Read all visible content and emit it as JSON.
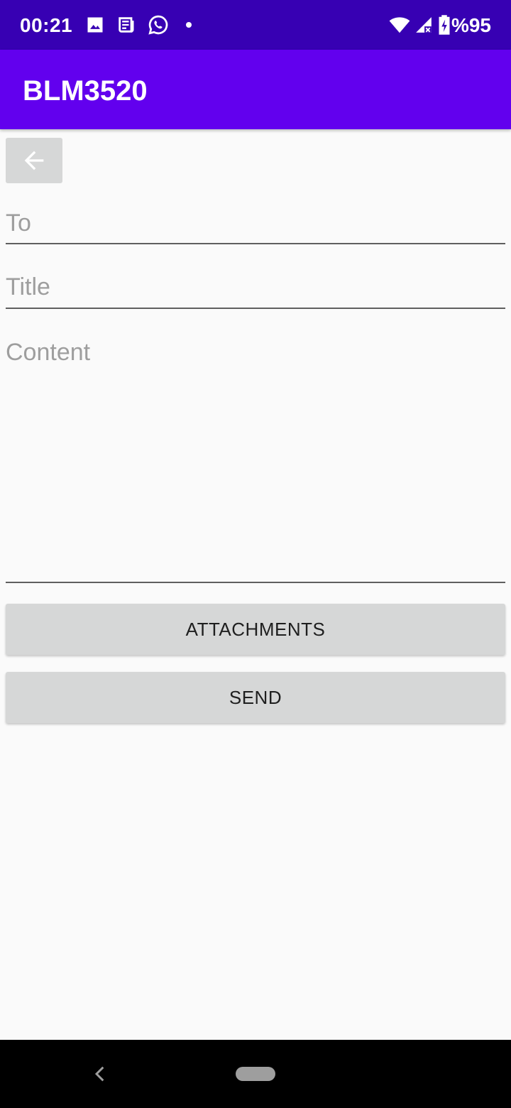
{
  "status_bar": {
    "time": "00:21",
    "battery": "%95",
    "notification_icons": [
      "image-icon",
      "news-icon",
      "whatsapp-icon",
      "dot-icon"
    ],
    "system_icons": [
      "wifi-icon",
      "signal-icon",
      "battery-charging-icon"
    ]
  },
  "app_bar": {
    "title": "BLM3520",
    "color": "#6200ee"
  },
  "back_button": {
    "icon": "arrow-left-icon"
  },
  "form": {
    "to_placeholder": "To",
    "title_placeholder": "Title",
    "content_placeholder": "Content"
  },
  "buttons": {
    "attachments_label": "ATTACHMENTS",
    "send_label": "SEND"
  },
  "nav_bar": {
    "back_icon": "chevron-left-icon",
    "home_icon": "home-pill-icon"
  }
}
